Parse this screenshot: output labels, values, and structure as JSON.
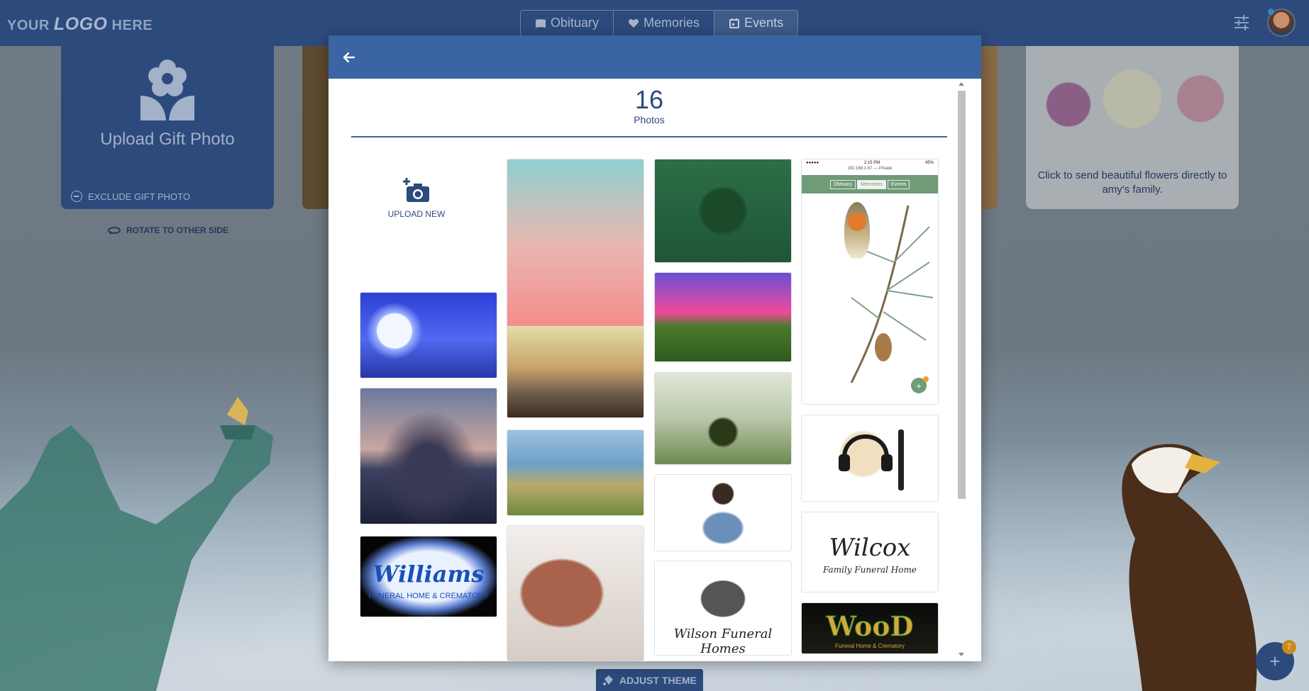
{
  "header": {
    "logo_prefix": "YOUR",
    "logo_main": "LOGO",
    "logo_suffix": "HERE",
    "tabs": [
      {
        "label": "Obituary",
        "icon": "book-icon"
      },
      {
        "label": "Memories",
        "icon": "heart-icon"
      },
      {
        "label": "Events",
        "icon": "calendar-icon"
      }
    ],
    "active_tab": "Events"
  },
  "gift": {
    "title": "Upload Gift Photo",
    "exclude_label": "EXCLUDE GIFT PHOTO",
    "rotate_label": "ROTATE TO OTHER SIDE"
  },
  "flowers": {
    "text": "Click to send beautiful flowers directly to amy's family."
  },
  "adjust_theme_label": "ADJUST THEME",
  "fab": {
    "label": "+",
    "badge": "7"
  },
  "modal": {
    "photo_count": "16",
    "photo_count_label": "Photos",
    "upload_label": "UPLOAD NEW",
    "photos": [
      {
        "name": "moon-photo"
      },
      {
        "name": "tree-sunset-photo"
      },
      {
        "name": "williams-logo-photo",
        "title": "Williams",
        "subtitle": "FUNERAL HOME & CREMATORY"
      },
      {
        "name": "lightbulb-photo"
      },
      {
        "name": "book-tree-photo"
      },
      {
        "name": "woman-beach-photo"
      },
      {
        "name": "dove-photo"
      },
      {
        "name": "forest-plane-photo"
      },
      {
        "name": "pink-sky-photo"
      },
      {
        "name": "butterfly-photo"
      },
      {
        "name": "woman-denim-photo"
      },
      {
        "name": "wilson-logo-photo",
        "title": "Wilson Funeral Homes"
      },
      {
        "name": "robin-screenshot-photo",
        "time": "2:15 PM",
        "battery": "45%",
        "url": "192.168.1.67 — Private",
        "tabs": [
          "Obituary",
          "Memories",
          "Events"
        ]
      },
      {
        "name": "headphones-photo"
      },
      {
        "name": "wilcox-logo-photo",
        "title": "Wilcox",
        "subtitle": "Family Funeral Home"
      },
      {
        "name": "wood-logo-photo",
        "title": "WooD",
        "subtitle": "Funeral Home & Crematory"
      }
    ]
  },
  "colors": {
    "primary": "#2c4a7c",
    "modal_header": "#3b64a3",
    "badge": "#c98a1f"
  }
}
